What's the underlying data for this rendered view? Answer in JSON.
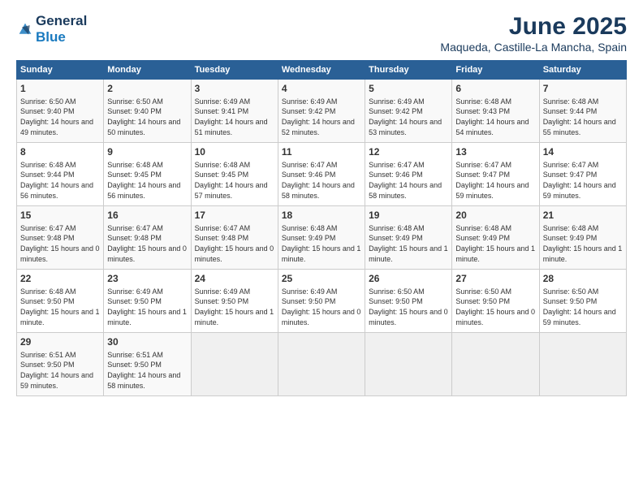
{
  "header": {
    "logo_line1": "General",
    "logo_line2": "Blue",
    "main_title": "June 2025",
    "subtitle": "Maqueda, Castille-La Mancha, Spain"
  },
  "calendar": {
    "days_of_week": [
      "Sunday",
      "Monday",
      "Tuesday",
      "Wednesday",
      "Thursday",
      "Friday",
      "Saturday"
    ],
    "weeks": [
      [
        {
          "day": "",
          "empty": true
        },
        {
          "day": "",
          "empty": true
        },
        {
          "day": "",
          "empty": true
        },
        {
          "day": "",
          "empty": true
        },
        {
          "day": "",
          "empty": true
        },
        {
          "day": "",
          "empty": true
        },
        {
          "day": "",
          "empty": true
        }
      ],
      [
        {
          "day": "1",
          "rise": "6:50 AM",
          "set": "9:40 PM",
          "daylight": "14 hours and 49 minutes."
        },
        {
          "day": "2",
          "rise": "6:50 AM",
          "set": "9:40 PM",
          "daylight": "14 hours and 50 minutes."
        },
        {
          "day": "3",
          "rise": "6:49 AM",
          "set": "9:41 PM",
          "daylight": "14 hours and 51 minutes."
        },
        {
          "day": "4",
          "rise": "6:49 AM",
          "set": "9:42 PM",
          "daylight": "14 hours and 52 minutes."
        },
        {
          "day": "5",
          "rise": "6:49 AM",
          "set": "9:42 PM",
          "daylight": "14 hours and 53 minutes."
        },
        {
          "day": "6",
          "rise": "6:48 AM",
          "set": "9:43 PM",
          "daylight": "14 hours and 54 minutes."
        },
        {
          "day": "7",
          "rise": "6:48 AM",
          "set": "9:44 PM",
          "daylight": "14 hours and 55 minutes."
        }
      ],
      [
        {
          "day": "8",
          "rise": "6:48 AM",
          "set": "9:44 PM",
          "daylight": "14 hours and 56 minutes."
        },
        {
          "day": "9",
          "rise": "6:48 AM",
          "set": "9:45 PM",
          "daylight": "14 hours and 56 minutes."
        },
        {
          "day": "10",
          "rise": "6:48 AM",
          "set": "9:45 PM",
          "daylight": "14 hours and 57 minutes."
        },
        {
          "day": "11",
          "rise": "6:47 AM",
          "set": "9:46 PM",
          "daylight": "14 hours and 58 minutes."
        },
        {
          "day": "12",
          "rise": "6:47 AM",
          "set": "9:46 PM",
          "daylight": "14 hours and 58 minutes."
        },
        {
          "day": "13",
          "rise": "6:47 AM",
          "set": "9:47 PM",
          "daylight": "14 hours and 59 minutes."
        },
        {
          "day": "14",
          "rise": "6:47 AM",
          "set": "9:47 PM",
          "daylight": "14 hours and 59 minutes."
        }
      ],
      [
        {
          "day": "15",
          "rise": "6:47 AM",
          "set": "9:48 PM",
          "daylight": "15 hours and 0 minutes."
        },
        {
          "day": "16",
          "rise": "6:47 AM",
          "set": "9:48 PM",
          "daylight": "15 hours and 0 minutes."
        },
        {
          "day": "17",
          "rise": "6:47 AM",
          "set": "9:48 PM",
          "daylight": "15 hours and 0 minutes."
        },
        {
          "day": "18",
          "rise": "6:48 AM",
          "set": "9:49 PM",
          "daylight": "15 hours and 1 minute."
        },
        {
          "day": "19",
          "rise": "6:48 AM",
          "set": "9:49 PM",
          "daylight": "15 hours and 1 minute."
        },
        {
          "day": "20",
          "rise": "6:48 AM",
          "set": "9:49 PM",
          "daylight": "15 hours and 1 minute."
        },
        {
          "day": "21",
          "rise": "6:48 AM",
          "set": "9:49 PM",
          "daylight": "15 hours and 1 minute."
        }
      ],
      [
        {
          "day": "22",
          "rise": "6:48 AM",
          "set": "9:50 PM",
          "daylight": "15 hours and 1 minute."
        },
        {
          "day": "23",
          "rise": "6:49 AM",
          "set": "9:50 PM",
          "daylight": "15 hours and 1 minute."
        },
        {
          "day": "24",
          "rise": "6:49 AM",
          "set": "9:50 PM",
          "daylight": "15 hours and 1 minute."
        },
        {
          "day": "25",
          "rise": "6:49 AM",
          "set": "9:50 PM",
          "daylight": "15 hours and 0 minutes."
        },
        {
          "day": "26",
          "rise": "6:50 AM",
          "set": "9:50 PM",
          "daylight": "15 hours and 0 minutes."
        },
        {
          "day": "27",
          "rise": "6:50 AM",
          "set": "9:50 PM",
          "daylight": "15 hours and 0 minutes."
        },
        {
          "day": "28",
          "rise": "6:50 AM",
          "set": "9:50 PM",
          "daylight": "14 hours and 59 minutes."
        }
      ],
      [
        {
          "day": "29",
          "rise": "6:51 AM",
          "set": "9:50 PM",
          "daylight": "14 hours and 59 minutes."
        },
        {
          "day": "30",
          "rise": "6:51 AM",
          "set": "9:50 PM",
          "daylight": "14 hours and 58 minutes."
        },
        {
          "day": "",
          "empty": true
        },
        {
          "day": "",
          "empty": true
        },
        {
          "day": "",
          "empty": true
        },
        {
          "day": "",
          "empty": true
        },
        {
          "day": "",
          "empty": true
        }
      ]
    ]
  },
  "labels": {
    "sunrise_prefix": "Sunrise: ",
    "sunset_prefix": "Sunset: ",
    "daylight_prefix": "Daylight: "
  }
}
